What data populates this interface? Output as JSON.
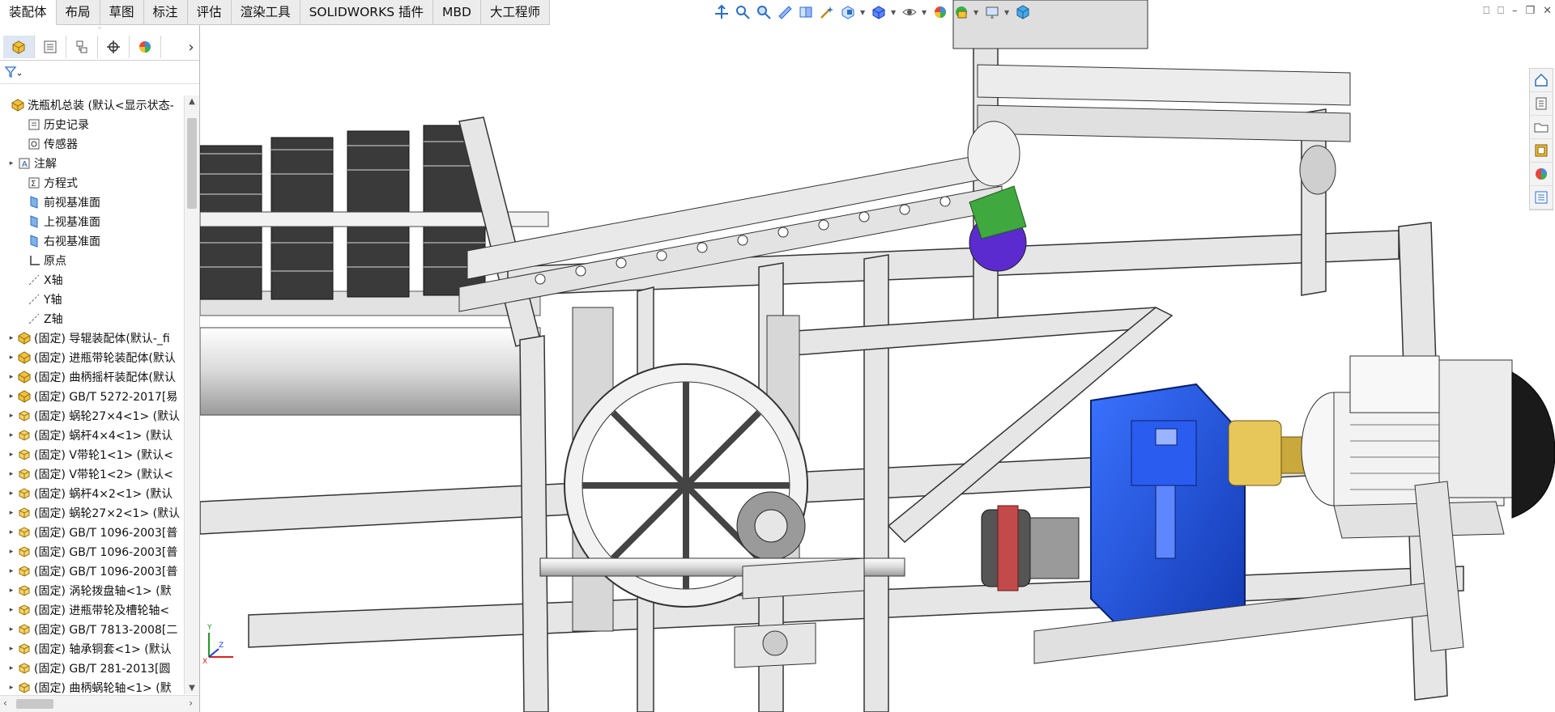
{
  "ribbon": {
    "tabs": [
      "装配体",
      "布局",
      "草图",
      "标注",
      "评估",
      "渲染工具",
      "SOLIDWORKS 插件",
      "MBD",
      "大工程师"
    ],
    "active_index": 0
  },
  "feature_tree": {
    "filter_icon": "filter-icon",
    "items": [
      {
        "label": "洗瓶机总装  (默认<显示状态-",
        "icon": "assembly-icon"
      },
      {
        "label": "历史记录",
        "icon": "history-icon"
      },
      {
        "label": "传感器",
        "icon": "sensor-icon"
      },
      {
        "label": "注解",
        "icon": "annotation-icon"
      },
      {
        "label": "方程式",
        "icon": "equation-icon"
      },
      {
        "label": "前视基准面",
        "icon": "plane-icon"
      },
      {
        "label": "上视基准面",
        "icon": "plane-icon"
      },
      {
        "label": "右视基准面",
        "icon": "plane-icon"
      },
      {
        "label": "原点",
        "icon": "origin-icon"
      },
      {
        "label": "X轴",
        "icon": "axis-icon"
      },
      {
        "label": "Y轴",
        "icon": "axis-icon"
      },
      {
        "label": "Z轴",
        "icon": "axis-icon"
      },
      {
        "label": "(固定) 导辊装配体(默认-_fi",
        "icon": "subassembly-icon"
      },
      {
        "label": "(固定) 进瓶带轮装配体(默认",
        "icon": "subassembly-icon"
      },
      {
        "label": "(固定) 曲柄摇杆装配体(默认",
        "icon": "subassembly-icon"
      },
      {
        "label": "(固定) GB/T 5272-2017[易",
        "icon": "subassembly-icon"
      },
      {
        "label": "(固定) 蜗轮27×4<1> (默认",
        "icon": "part-icon"
      },
      {
        "label": "(固定) 蜗杆4×4<1> (默认",
        "icon": "part-icon"
      },
      {
        "label": "(固定) V带轮1<1> (默认<",
        "icon": "part-icon"
      },
      {
        "label": "(固定) V带轮1<2> (默认<",
        "icon": "part-icon"
      },
      {
        "label": "(固定) 蜗杆4×2<1> (默认",
        "icon": "part-icon"
      },
      {
        "label": "(固定) 蜗轮27×2<1> (默认",
        "icon": "part-icon"
      },
      {
        "label": "(固定) GB/T 1096-2003[普",
        "icon": "part-icon"
      },
      {
        "label": "(固定) GB/T 1096-2003[普",
        "icon": "part-icon"
      },
      {
        "label": "(固定) GB/T 1096-2003[普",
        "icon": "part-icon"
      },
      {
        "label": "(固定) 涡轮拨盘轴<1> (默",
        "icon": "part-icon"
      },
      {
        "label": "(固定) 进瓶带轮及槽轮轴<",
        "icon": "part-icon"
      },
      {
        "label": "(固定) GB/T 7813-2008[二",
        "icon": "part-icon"
      },
      {
        "label": "(固定) 轴承铜套<1> (默认",
        "icon": "part-icon"
      },
      {
        "label": "(固定) GB/T 281-2013[圆",
        "icon": "part-icon"
      },
      {
        "label": "(固定) 曲柄蜗轮轴<1> (默",
        "icon": "part-icon"
      }
    ]
  },
  "colors": {
    "frame": "#e4e4e4",
    "gearbox": "#1d4fd8",
    "coupling_yellow": "#e8c75a",
    "coupling_red": "#c24a4a",
    "purple_part": "#5b2bd0",
    "green_part": "#3fa83f"
  },
  "triad": {
    "x": "X",
    "y": "Y",
    "z": "Z"
  }
}
